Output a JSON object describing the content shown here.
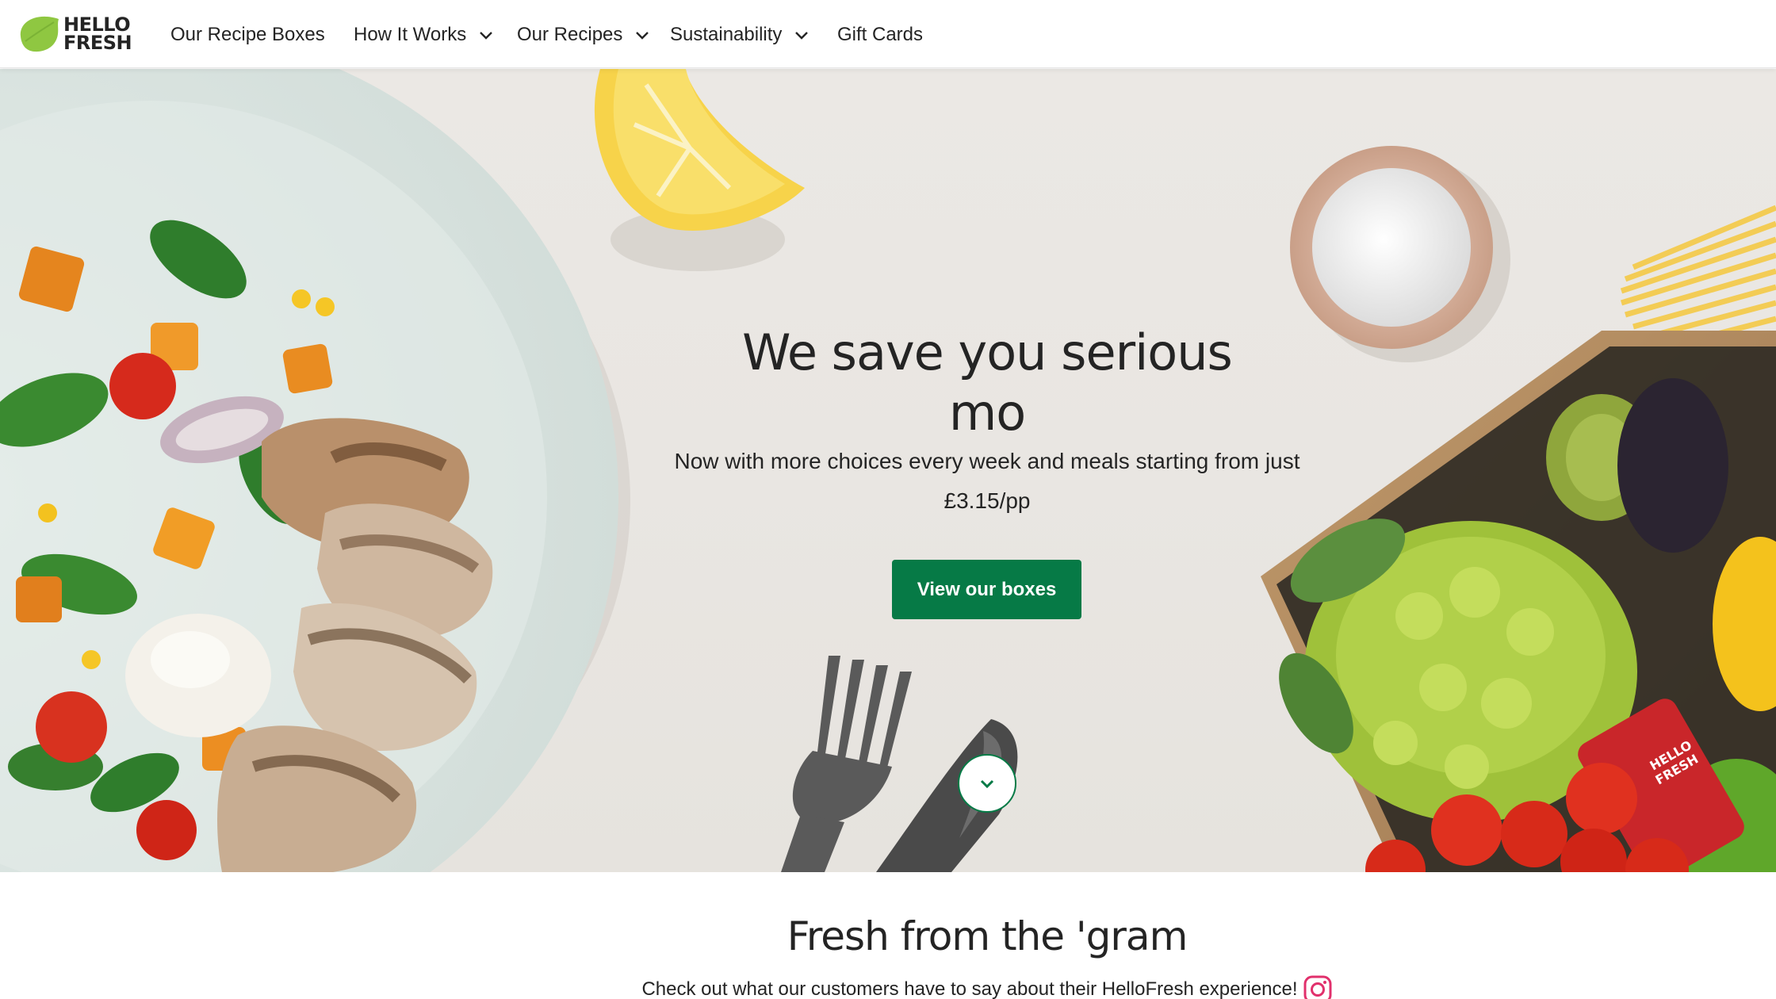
{
  "brand": {
    "logo_line1": "HELLO",
    "logo_line2": "FRESH",
    "green": "#8fc741",
    "dark_green": "#067a46"
  },
  "nav": {
    "items": [
      {
        "label": "Our Recipe Boxes",
        "has_dropdown": false
      },
      {
        "label": "How It Works",
        "has_dropdown": true
      },
      {
        "label": "Our Recipes",
        "has_dropdown": true
      },
      {
        "label": "Sustainability",
        "has_dropdown": true
      },
      {
        "label": "Gift Cards",
        "has_dropdown": false
      }
    ]
  },
  "hero": {
    "headline_line1": "We save you serious",
    "headline_line2": "mo",
    "subline_line1": "Now with more choices every week and meals starting from just",
    "subline_line2": "£3.15/pp",
    "cta_label": "View our boxes",
    "tin_label_line1": "HELLO",
    "tin_label_line2": "FRESH"
  },
  "gram": {
    "title": "Fresh from the 'gram",
    "subtitle": "Check out what our customers have to say about their HelloFresh experience!"
  },
  "icons": {
    "chevron": "chevron-down-icon",
    "instagram": "instagram-icon",
    "scroll": "scroll-down-icon"
  }
}
